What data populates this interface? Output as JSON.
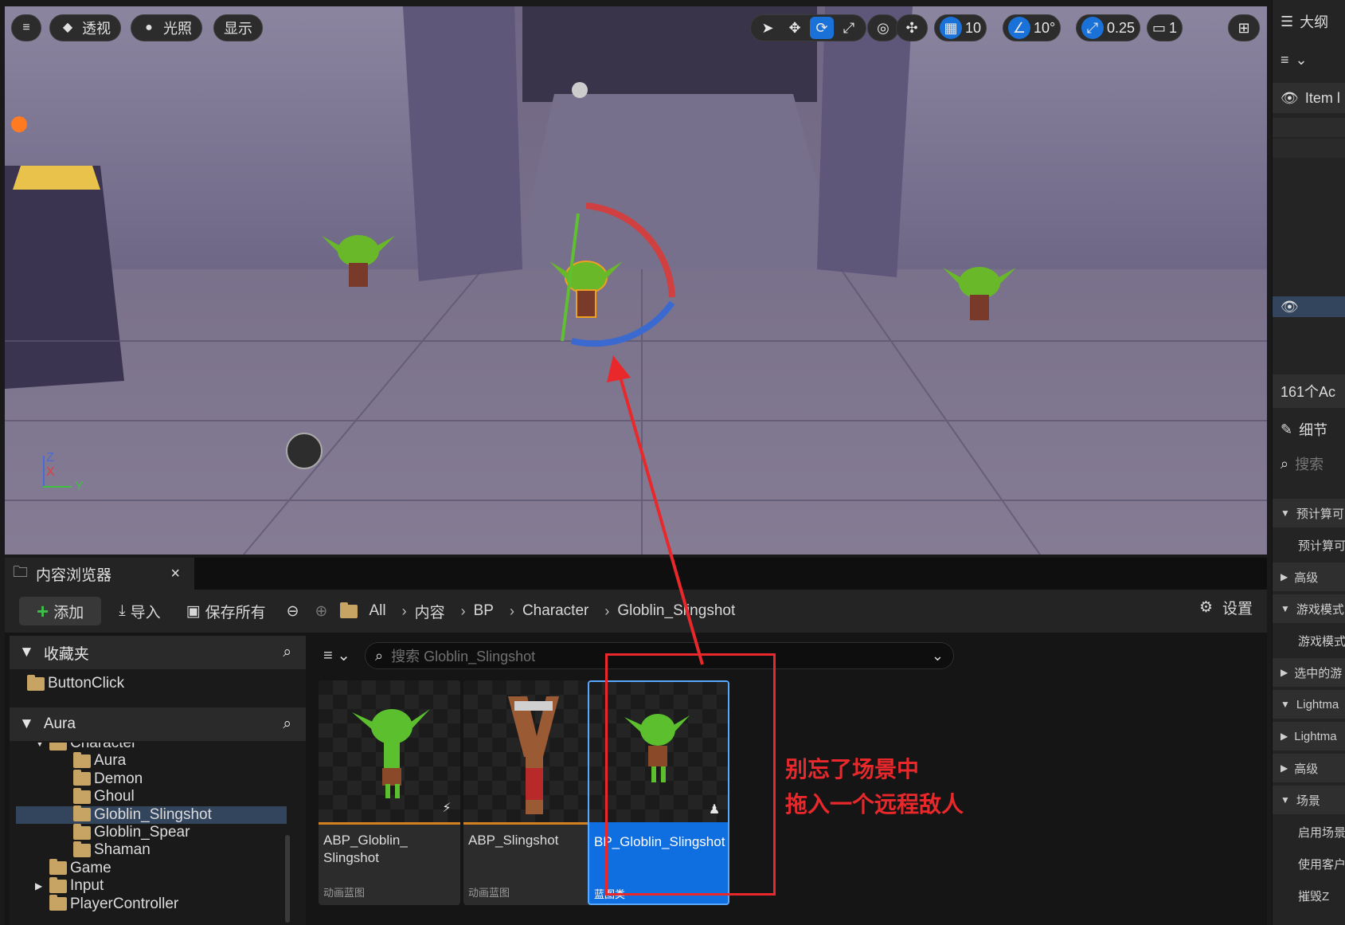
{
  "viewport": {
    "menu_icon": "hamburger-icon",
    "perspective_label": "透视",
    "lighting_label": "光照",
    "show_label": "显示",
    "grid_snap_value": "10",
    "rotation_snap_value": "10°",
    "scale_snap_value": "0.25",
    "camera_speed_value": "1",
    "axis_z": "Z",
    "axis_x": "X",
    "axis_y": "Y"
  },
  "right_panel": {
    "outliner_title": "大纲",
    "item_label_column": "Item l",
    "actor_count": "161个Ac",
    "details_title": "细节",
    "search_placeholder": "搜索",
    "sections": [
      {
        "label": "预计算可",
        "expanded": true
      },
      {
        "label": "预计算可",
        "sub": true
      },
      {
        "label": "高级",
        "expanded": false
      },
      {
        "label": "游戏模式",
        "expanded": true
      },
      {
        "label": "游戏模式",
        "sub": true
      },
      {
        "label": "选中的游",
        "expanded": false
      },
      {
        "label": "Lightma",
        "expanded": true
      },
      {
        "label": "Lightma",
        "expanded": false
      },
      {
        "label": "高级",
        "expanded": false
      },
      {
        "label": "场景",
        "expanded": true
      },
      {
        "label": "启用场景",
        "sub": true
      },
      {
        "label": "使用客户",
        "sub": true
      },
      {
        "label": "摧毁Z",
        "sub": true
      }
    ]
  },
  "content_browser": {
    "tab_title": "内容浏览器",
    "close_glyph": "×",
    "add_label": "添加",
    "import_label": "导入",
    "save_all_label": "保存所有",
    "settings_label": "设置",
    "breadcrumbs": [
      "All",
      "内容",
      "BP",
      "Character",
      "Globlin_Slingshot"
    ],
    "search_placeholder": "搜索 Globlin_Slingshot",
    "favorites_title": "收藏夹",
    "favorites_items": [
      "ButtonClick"
    ],
    "project_title": "Aura",
    "tree": [
      {
        "label": "Character",
        "indent": 1,
        "expanded": true
      },
      {
        "label": "Aura",
        "indent": 2
      },
      {
        "label": "Demon",
        "indent": 2
      },
      {
        "label": "Ghoul",
        "indent": 2
      },
      {
        "label": "Globlin_Slingshot",
        "indent": 2,
        "selected": true
      },
      {
        "label": "Globlin_Spear",
        "indent": 2
      },
      {
        "label": "Shaman",
        "indent": 2
      },
      {
        "label": "Game",
        "indent": 1
      },
      {
        "label": "Input",
        "indent": 1,
        "collapsed": true
      },
      {
        "label": "PlayerController",
        "indent": 1
      }
    ],
    "assets": [
      {
        "name": "ABP_Globlin_\nSlingshot",
        "type": "动画蓝图",
        "selected": false
      },
      {
        "name": "ABP_Slingshot",
        "type": "动画蓝图",
        "selected": false
      },
      {
        "name": "BP_Globlin_Slingshot",
        "type": "蓝图类",
        "selected": true
      }
    ]
  },
  "annotation": {
    "line1": "别忘了场景中",
    "line2": "拖入一个远程敌人",
    "color": "#e8282b"
  }
}
